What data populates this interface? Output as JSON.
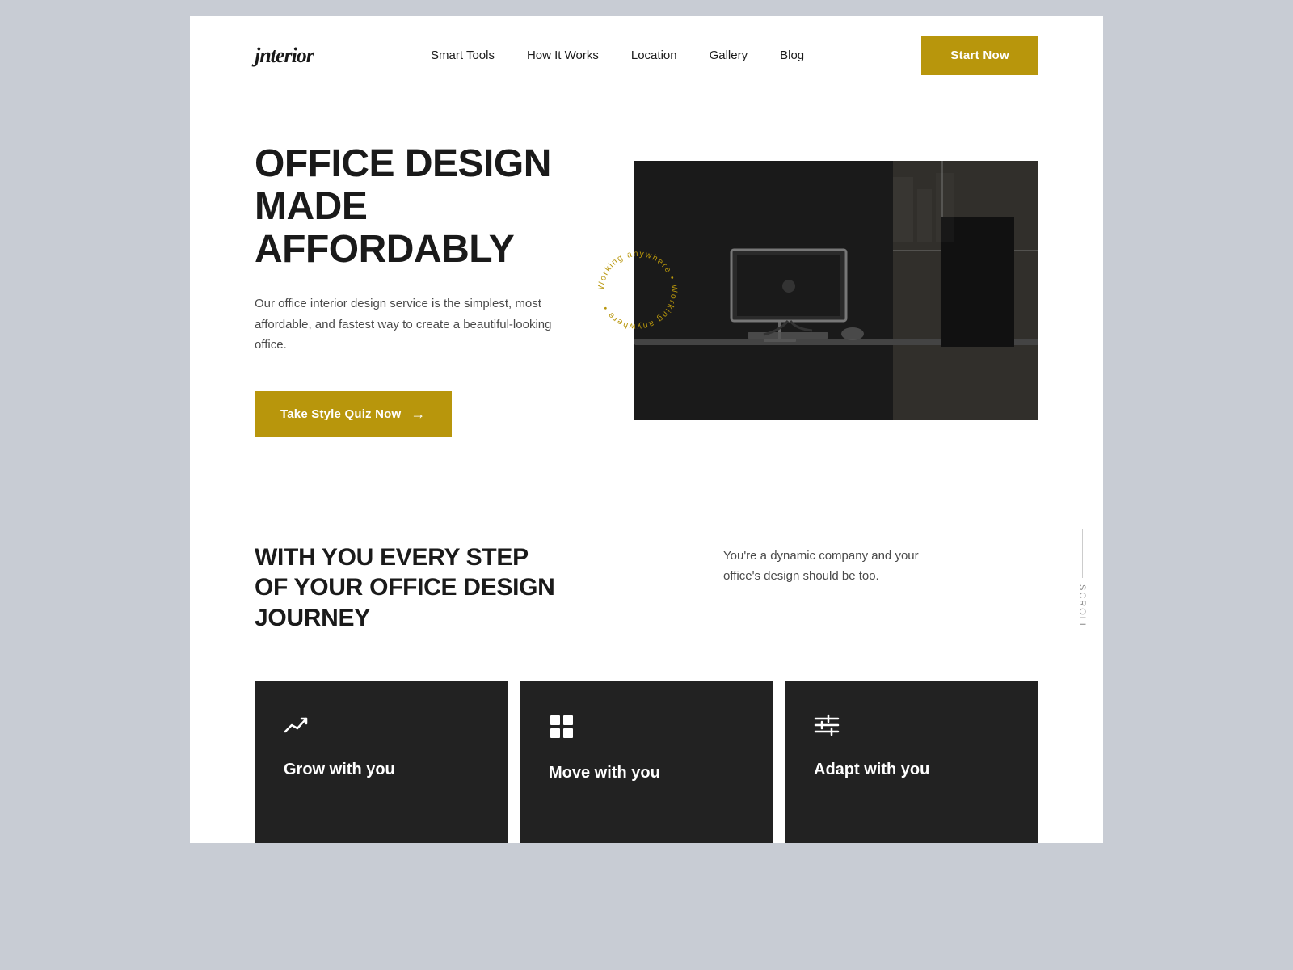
{
  "brand": {
    "logo": "jnterior"
  },
  "navbar": {
    "links": [
      {
        "label": "Smart Tools",
        "href": "#"
      },
      {
        "label": "How It Works",
        "href": "#"
      },
      {
        "label": "Location",
        "href": "#"
      },
      {
        "label": "Gallery",
        "href": "#"
      },
      {
        "label": "Blog",
        "href": "#"
      }
    ],
    "cta_label": "Start Now"
  },
  "hero": {
    "title_line1": "OFFICE DESIGN",
    "title_line2": "MADE AFFORDABLY",
    "description": "Our office interior design service is the simplest, most affordable, and fastest way to create a beautiful-looking office.",
    "cta_label": "Take Style Quiz Now",
    "circular_text": "Working anywhere"
  },
  "journey": {
    "title_line1": "WITH YOU EVERY STEP",
    "title_line2": "OF YOUR OFFICE DESIGN JOURNEY",
    "description": "You're a dynamic company and your office's design should be too.",
    "scroll_label": "SCROLL"
  },
  "cards": [
    {
      "icon_type": "trend",
      "title": "Grow with you"
    },
    {
      "icon_type": "grid",
      "title": "Move with you"
    },
    {
      "icon_type": "sliders",
      "title": "Adapt with you"
    }
  ],
  "colors": {
    "accent": "#b8960c",
    "dark": "#222222",
    "text": "#1a1a1a",
    "muted": "#4a4a4a"
  }
}
